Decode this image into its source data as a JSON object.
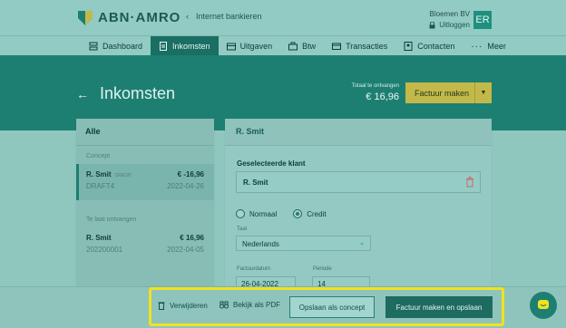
{
  "header": {
    "brand": "ABN·AMRO",
    "back_link": "Internet bankieren",
    "company": "Bloemen BV",
    "logout": "Uitloggen",
    "avatar_initials": "ER"
  },
  "nav": {
    "items": [
      {
        "label": "Dashboard",
        "icon": "dashboard-icon",
        "active": false
      },
      {
        "label": "Inkomsten",
        "icon": "document-icon",
        "active": true
      },
      {
        "label": "Uitgaven",
        "icon": "wallet-icon",
        "active": false
      },
      {
        "label": "Btw",
        "icon": "briefcase-icon",
        "active": false
      },
      {
        "label": "Transacties",
        "icon": "card-icon",
        "active": false
      },
      {
        "label": "Contacten",
        "icon": "contact-icon",
        "active": false
      },
      {
        "label": "Meer",
        "icon": "more-icon",
        "active": false
      }
    ]
  },
  "hero": {
    "title": "Inkomsten",
    "total_label": "Totaal te ontvangen",
    "total_value": "€ 16,96",
    "cta_label": "Factuur maken"
  },
  "invoice_list": {
    "header": "Alle",
    "groups": [
      {
        "label": "Concept",
        "items": [
          {
            "name": "R. Smit",
            "badge": "CREDIT",
            "number": "DRAFT4",
            "amount": "€ -16,96",
            "date": "2022-04-26",
            "selected": true
          }
        ]
      },
      {
        "label": "Te laat ontvangen",
        "items": [
          {
            "name": "R. Smit",
            "badge": "",
            "number": "202200001",
            "amount": "€ 16,96",
            "date": "2022-04-05",
            "selected": false
          }
        ]
      }
    ]
  },
  "detail": {
    "header": "R. Smit",
    "selected_client_label": "Geselecteerde klant",
    "client_name": "R. Smit",
    "invoice_type": {
      "options": [
        "Normaal",
        "Credit"
      ],
      "selected": "Credit"
    },
    "language_label": "Taal",
    "language_value": "Nederlands",
    "invoice_date_label": "Factuurdatum",
    "invoice_date_value": "26-04-2022",
    "period_label": "Periode",
    "period_value": "14"
  },
  "footer": {
    "delete_label": "Verwijderen",
    "pdf_label": "Bekijk als PDF",
    "save_concept_label": "Opslaan als concept",
    "create_save_label": "Factuur maken en opslaan"
  },
  "colors": {
    "accent": "#1d7f72",
    "highlight": "#f2e21d",
    "cta": "#c2b94a"
  }
}
